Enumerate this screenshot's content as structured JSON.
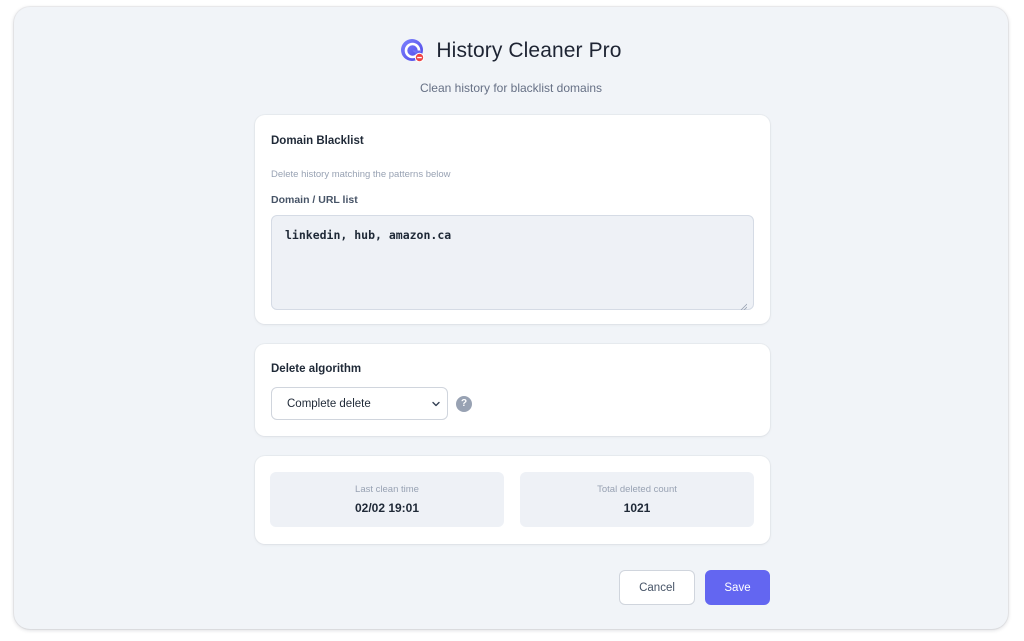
{
  "app": {
    "title": "History Cleaner Pro",
    "subtitle": "Clean history for blacklist domains",
    "logo_icon": "circular-arrow-logo-icon",
    "accent_color": "#6366f1"
  },
  "blacklist": {
    "title": "Domain Blacklist",
    "description": "Delete history matching the patterns below",
    "field_label": "Domain / URL list",
    "value": "linkedin, hub, amazon.ca"
  },
  "algorithm": {
    "title": "Delete algorithm",
    "selected": "Complete delete",
    "help_label": "?"
  },
  "stats": {
    "last_clean_label": "Last clean time",
    "last_clean_value": "02/02 19:01",
    "total_deleted_label": "Total deleted count",
    "total_deleted_value": "1021"
  },
  "actions": {
    "cancel_label": "Cancel",
    "save_label": "Save"
  }
}
